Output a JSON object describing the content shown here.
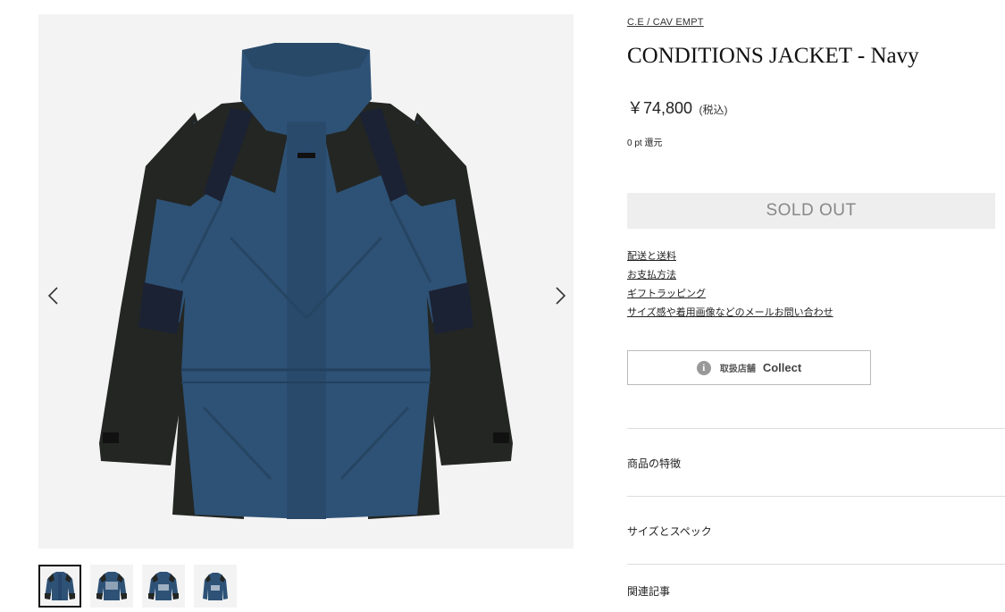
{
  "gallery": {
    "prev_icon": "chevron-left-icon",
    "next_icon": "chevron-right-icon",
    "thumbnails": [
      {
        "name": "thumbnail-front",
        "active": true
      },
      {
        "name": "thumbnail-back",
        "active": false
      },
      {
        "name": "thumbnail-back-2",
        "active": false
      },
      {
        "name": "thumbnail-back-3",
        "active": false
      }
    ]
  },
  "product": {
    "brand": "C.E / CAV EMPT",
    "title": "CONDITIONS JACKET - Navy",
    "price": "￥74,800",
    "price_tax": "(税込)",
    "points": "0 pt 還元",
    "sold_out_label": "SOLD OUT"
  },
  "links": [
    "配送と送料",
    "お支払方法",
    "ギフトラッピング",
    "サイズ感や着用画像などのメールお問い合わせ"
  ],
  "store": {
    "icon": "info-icon",
    "icon_glyph": "i",
    "label": "取扱店舗",
    "name": "Collect"
  },
  "accordions": [
    "商品の特徴",
    "サイズとスペック",
    "関連記事"
  ],
  "colors": {
    "jacket_blue": "#2e5276",
    "jacket_dark": "#232623",
    "jacket_navy": "#1b2233",
    "sold_out_bg": "#eeeeee",
    "sold_out_text": "#888888"
  }
}
